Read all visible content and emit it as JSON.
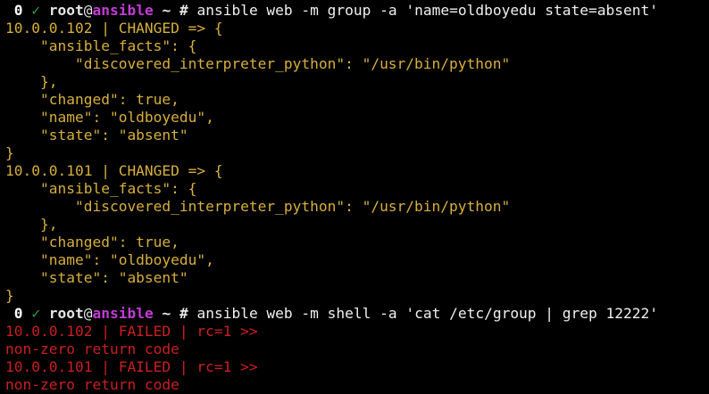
{
  "colors": {
    "background": "#000000",
    "success_output": "#d7af3c",
    "failed_output": "#cc1f1f",
    "prompt_host": "#c33bd6",
    "prompt_check": "#2ea043"
  },
  "prompts": [
    {
      "status": "0",
      "check": "✓",
      "user": "root",
      "at": "@",
      "host": "ansible",
      "cwd": "~",
      "symbol": "#",
      "command": "ansible web -m group -a 'name=oldboyedu state=absent'"
    },
    {
      "status": "0",
      "check": "✓",
      "user": "root",
      "at": "@",
      "host": "ansible",
      "cwd": "~",
      "symbol": "#",
      "command": "ansible web -m shell -a 'cat /etc/group | grep 12222'"
    }
  ],
  "output_group": [
    "10.0.0.102 | CHANGED => {",
    "    \"ansible_facts\": {",
    "        \"discovered_interpreter_python\": \"/usr/bin/python\"",
    "    },",
    "    \"changed\": true,",
    "    \"name\": \"oldboyedu\",",
    "    \"state\": \"absent\"",
    "}",
    "10.0.0.101 | CHANGED => {",
    "    \"ansible_facts\": {",
    "        \"discovered_interpreter_python\": \"/usr/bin/python\"",
    "    },",
    "    \"changed\": true,",
    "    \"name\": \"oldboyedu\",",
    "    \"state\": \"absent\"",
    "}"
  ],
  "output_shell": [
    "10.0.0.102 | FAILED | rc=1 >>",
    "non-zero return code",
    "10.0.0.101 | FAILED | rc=1 >>",
    "non-zero return code"
  ]
}
